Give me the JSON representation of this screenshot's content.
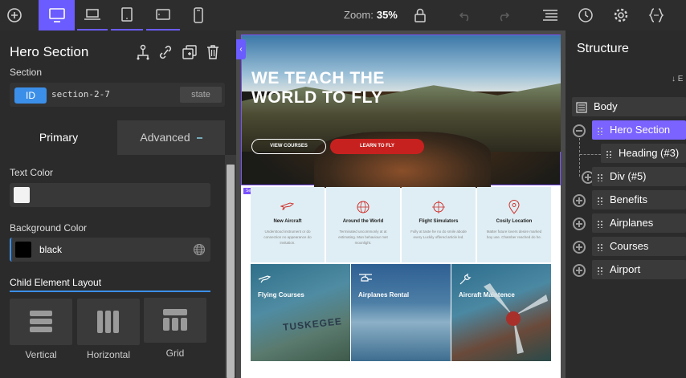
{
  "toolbar": {
    "zoom_label": "Zoom:",
    "zoom_value": "35%"
  },
  "element_panel": {
    "title": "Hero Section",
    "section_label": "Section",
    "id_badge": "ID",
    "id_value": "section-2-7",
    "state_label": "state",
    "tabs": [
      "Primary",
      "Advanced"
    ],
    "text_color_label": "Text Color",
    "text_color_hex": "#f2f2f2",
    "background_color_label": "Background Color",
    "background_color_value": "black",
    "background_color_hex": "#000000",
    "child_layout_label": "Child Element Layout",
    "layouts": [
      "Vertical",
      "Horizontal",
      "Grid"
    ]
  },
  "canvas": {
    "hero_heading": "WE TEACH THE WORLD TO FLY",
    "button_view_courses": "VIEW COURSES",
    "button_learn_to_fly": "LEARN TO FLY",
    "section_tag": "Section",
    "features": [
      {
        "title": "New Aircraft",
        "text": "Understood instrument or do connection no appearance do invitation.",
        "icon": "plane-icon"
      },
      {
        "title": "Around the World",
        "text": "Terminated uncommonly at at estimating. Man behaviour met moonlight.",
        "icon": "globe-icon"
      },
      {
        "title": "Flight Simulators",
        "text": "Fully at taste he no do smile abode every Luckily offered article led.",
        "icon": "crosshair-icon"
      },
      {
        "title": "Cosily Location",
        "text": "Matter future lovers desire marked boy use. Chamber reached do he.",
        "icon": "location-icon"
      }
    ],
    "cards": [
      {
        "title": "Flying Courses",
        "icon": "plane-icon"
      },
      {
        "title": "Airplanes Rental",
        "icon": "helicopter-icon"
      },
      {
        "title": "Aircraft Maintence",
        "icon": "wrench-icon"
      }
    ],
    "card_plane_text": "TUSKEGEE"
  },
  "structure_panel": {
    "title": "Structure",
    "expand_label": "↓ E",
    "items": [
      {
        "label": "Body",
        "active": false
      },
      {
        "label": "Hero Section",
        "active": true
      },
      {
        "label": "Heading (#3)",
        "active": false
      },
      {
        "label": "Div (#5)",
        "active": false
      },
      {
        "label": "Benefits",
        "active": false
      },
      {
        "label": "Airplanes",
        "active": false
      },
      {
        "label": "Courses",
        "active": false
      },
      {
        "label": "Airport",
        "active": false
      }
    ]
  },
  "colors": {
    "accent_blue": "#3b8fe8",
    "active_purple": "#7b63ff",
    "device_active": "#6b5cff",
    "cta_red": "#c7211f"
  }
}
